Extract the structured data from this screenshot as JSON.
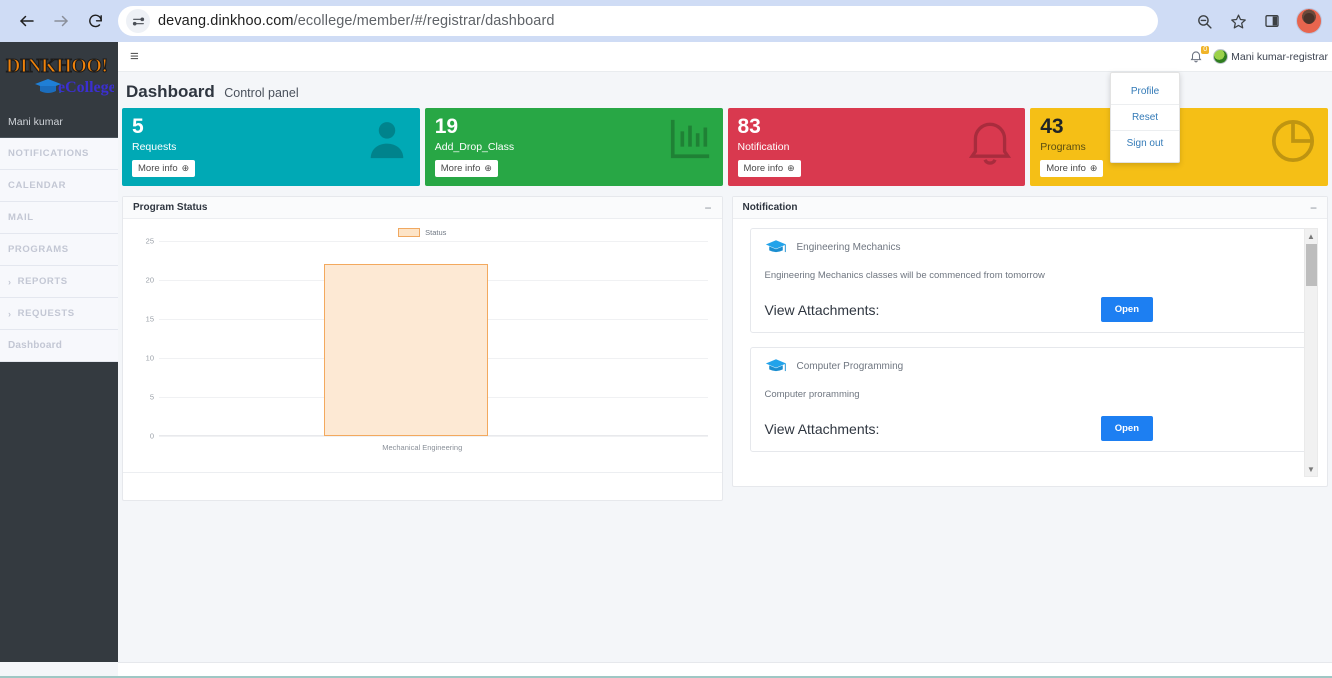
{
  "browser": {
    "back_icon": "back-arrow-icon",
    "forward_icon": "forward-arrow-icon",
    "reload_icon": "reload-icon",
    "site_info_icon": "site-settings-icon",
    "url_host": "devang.dinkhoo.com",
    "url_path": "/ecollege/member/#/registrar/dashboard",
    "zoom_icon": "zoom-out-icon",
    "bookmark_icon": "star-icon",
    "side_panel_icon": "side-panel-icon",
    "profile_avatar": "profile-avatar"
  },
  "sidebar": {
    "brand_main": "DINKHOO!",
    "brand_sub": "eCollege",
    "user_name": "Mani kumar",
    "items": [
      {
        "label": "NOTIFICATIONS",
        "chevron": ""
      },
      {
        "label": "CALENDAR",
        "chevron": ""
      },
      {
        "label": "MAIL",
        "chevron": ""
      },
      {
        "label": "PROGRAMS",
        "chevron": ""
      },
      {
        "label": "REPORTS",
        "chevron": "›"
      },
      {
        "label": "REQUESTS",
        "chevron": "›"
      },
      {
        "label": "Dashboard",
        "chevron": ""
      }
    ]
  },
  "topbar": {
    "menu_toggle": "≡",
    "bell_badge": "0",
    "username": "Mani kumar-registrar"
  },
  "user_dropdown": {
    "items": [
      "Profile",
      "Reset",
      "Sign out"
    ]
  },
  "page": {
    "title": "Dashboard",
    "subtitle": "Control panel"
  },
  "cards": [
    {
      "value": "5",
      "label": "Requests",
      "more": "More info",
      "more_icon": "⊕",
      "color": "#00a9b5",
      "icon": "user-icon"
    },
    {
      "value": "19",
      "label": "Add_Drop_Class",
      "more": "More info",
      "more_icon": "⊕",
      "color": "#28a745",
      "icon": "bar-chart-icon"
    },
    {
      "value": "83",
      "label": "Notification",
      "more": "More info",
      "more_icon": "⊕",
      "color": "#d9394f",
      "icon": "bell-icon"
    },
    {
      "value": "43",
      "label": "Programs",
      "more": "More info",
      "more_icon": "⊕",
      "color": "#f5bf16",
      "icon": "pie-chart-icon"
    }
  ],
  "chart_panel": {
    "title": "Program Status",
    "minimize_icon": "−"
  },
  "chart_data": {
    "type": "bar",
    "title": "Program Status",
    "categories": [
      "Mechanical Engineering"
    ],
    "values": [
      22
    ],
    "series": [
      {
        "name": "Status",
        "values": [
          22
        ]
      }
    ],
    "legend": [
      "Status"
    ],
    "legend_position": "top-center",
    "xlabel": "",
    "ylabel": "",
    "ylim": [
      0,
      25
    ],
    "yticks": [
      0,
      5,
      10,
      15,
      20,
      25
    ],
    "grid": true,
    "bar_fill": "#fde9d4",
    "bar_border": "#f3a95e"
  },
  "notification_panel": {
    "title": "Notification",
    "minimize_icon": "−",
    "scroll_up_icon": "▲",
    "scroll_down_icon": "▼",
    "items": [
      {
        "course": "Engineering Mechanics",
        "message": "Engineering Mechanics classes will be commenced from tomorrow",
        "attachments_label": "View Attachments:",
        "open_button": "Open",
        "icon": "graduation-cap-icon"
      },
      {
        "course": "Computer Programming",
        "message": "Computer proramming",
        "attachments_label": "View Attachments:",
        "open_button": "Open",
        "icon": "graduation-cap-icon"
      }
    ]
  }
}
